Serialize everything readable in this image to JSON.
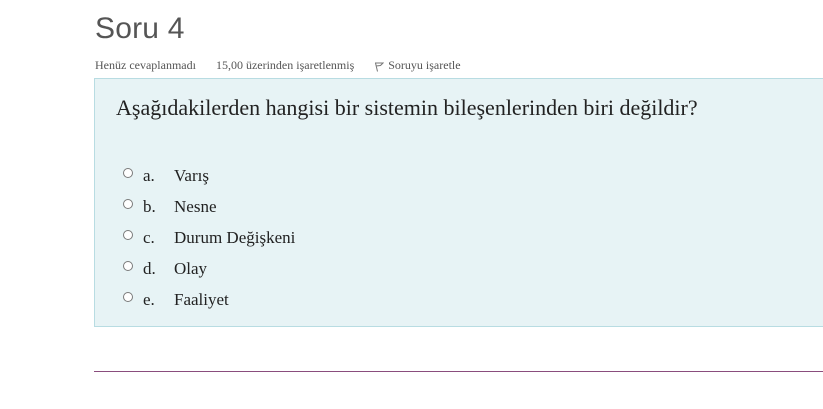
{
  "question": {
    "title": "Soru 4",
    "status": "Henüz cevaplanmadı",
    "marks": "15,00 üzerinden işaretlenmiş",
    "flag_label": "Soruyu işaretle",
    "text": "Aşağıdakilerden hangisi bir sistemin bileşenlerinden biri değildir?",
    "answers": [
      {
        "letter": "a.",
        "text": "Varış"
      },
      {
        "letter": "b.",
        "text": "Nesne"
      },
      {
        "letter": "c.",
        "text": "Durum Değişkeni"
      },
      {
        "letter": "d.",
        "text": "Olay"
      },
      {
        "letter": "e.",
        "text": "Faaliyet"
      }
    ]
  },
  "colors": {
    "box_background": "#e7f3f5",
    "box_border": "#b8dce2",
    "divider": "#8a4d7d"
  }
}
